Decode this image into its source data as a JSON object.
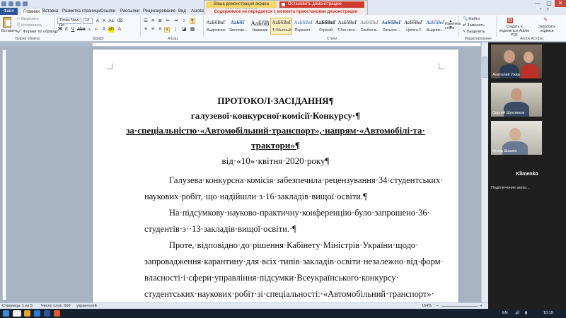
{
  "window": {
    "controls": [
      "—",
      "□",
      "✕"
    ]
  },
  "demo": {
    "status": "Ваша демонстрация экрана приостановлена",
    "stop_label": "Остановить демонстрацию",
    "notice": "Содержимое не передается с момента приостановки демонстрации"
  },
  "ribbon_tabs": [
    "Файл",
    "Главная",
    "Вставка",
    "Разметка страницы",
    "Ссылки",
    "Рассылки",
    "Рецензирование",
    "Вид",
    "Acrobat"
  ],
  "clipboard": {
    "paste": "Вставить",
    "cut": "Вырезать",
    "copy": "Копировать",
    "format": "Формат по образцу",
    "group": "Буфер обмена"
  },
  "font": {
    "name": "Times New Ro",
    "size": "14",
    "group": "Шрифт"
  },
  "paragraph": {
    "group": "Абзац"
  },
  "styles": {
    "group": "Стили",
    "tiles": [
      {
        "preview": "АаБбВвГ",
        "name": "Выделение"
      },
      {
        "preview": "АаБбГ",
        "name": "Заголово..."
      },
      {
        "preview": "АаБбВ",
        "name": "Название"
      },
      {
        "preview": "АаБбВвГ",
        "name": "¶ Обычный"
      },
      {
        "preview": "АаБбВвГ",
        "name": "Подзагол..."
      },
      {
        "preview": "АаБбВвГ",
        "name": "Строгий"
      },
      {
        "preview": "АаБбВвГ",
        "name": "¶ Без инте..."
      },
      {
        "preview": "АаБбВвГ",
        "name": "Слабое в..."
      },
      {
        "preview": "АаБбВвГ",
        "name": "Сильное ..."
      },
      {
        "preview": "АаБбВвГ",
        "name": "Цитата 2"
      },
      {
        "preview": "АаБбВвГ",
        "name": "Выделен..."
      }
    ],
    "change": "Изменить стили"
  },
  "editing": {
    "group": "Редактирование",
    "find": "Найти",
    "replace": "Заменить",
    "select": "Выделить"
  },
  "acrobat": {
    "group": "Adobe Acrobat",
    "create_share": "Создать и поделиться Adobe PDF",
    "request": "Запросить подписи"
  },
  "document": {
    "title_lines": [
      "ПРОТОКОЛ·ЗАСІДАННЯ¶",
      "галузевої·конкурсної·комісії·Конкурсу·¶",
      "за·спеціальністю·«Автомобільний·транспорт»,·напрям·«Автомобілі·та·",
      "трактори»¶",
      "від·«10»·квітня·2020·року¶"
    ],
    "body_lines": [
      "Галузева·конкурсна·комісія·забезпечила·рецензування·34·студентських·",
      "наукових·робіт,·що·надійшли·з·16·закладів·вищої·освіти.¶",
      "На·підсумкову·науково-практичну·конференцію·було·запрошено·36·",
      "студентів·з··13·закладів·вищої·освіти.·¶",
      "Проте,·відповідно·до·рішення·Кабінету·Міністрів·України·щодо·",
      "запровадження·карантину·для·всіх·типів·закладів·освіти·незалежно·від·форм·",
      "власності·і·сфери·управління·підсумки·Всеукраїнського·конкурсу·",
      "студентських·наукових·робіт·зі·спеціальності:·«Автомобільний·транспорт»·"
    ]
  },
  "status_bar": {
    "page": "Страница: 1 из 5",
    "words": "Число слов: 560",
    "language": "украинский",
    "zoom": "164%"
  },
  "participants": [
    {
      "name": "Анатолий Ужва"
    },
    {
      "name": "Сергей Шуклинов"
    },
    {
      "name": "Игорь Шашко"
    }
  ],
  "speaker_name": "Klimenko",
  "connection_status": "Подключение звука...",
  "taskbar": {
    "lang": "EN",
    "time": "10:19"
  },
  "colors": {
    "accent": "#2b579a",
    "stop": "#d03b30",
    "banner": "#f4d66a"
  }
}
